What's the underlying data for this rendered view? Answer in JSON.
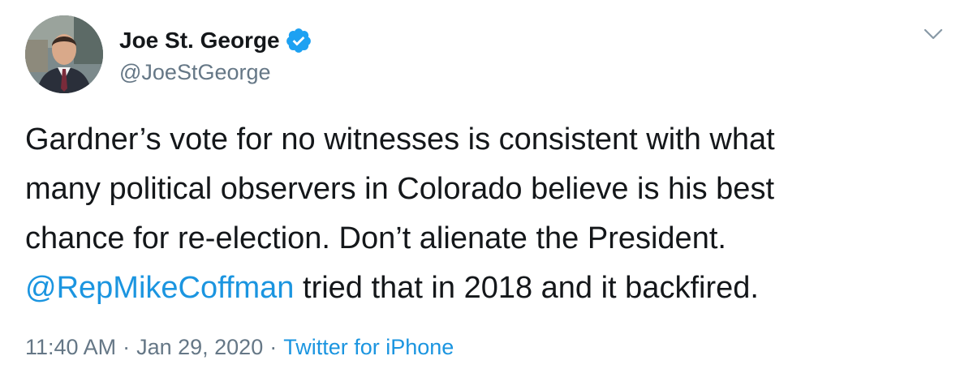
{
  "author": {
    "display_name": "Joe St. George",
    "handle": "@JoeStGeorge",
    "verified": true,
    "avatar_icon": "profile-photo"
  },
  "tweet": {
    "lines": [
      {
        "text": "Gardner’s vote for no witnesses is consistent with what"
      },
      {
        "text": "many political observers in Colorado believe is his best"
      },
      {
        "text": "chance for re-election. Don’t alienate the President."
      }
    ],
    "last_line": {
      "mention": "@RepMikeCoffman",
      "rest": " tried that in 2018 and it backfired."
    }
  },
  "meta": {
    "time": "11:40 AM",
    "separator": "·",
    "date": "Jan 29, 2020",
    "source": "Twitter for iPhone"
  },
  "icons": {
    "verified": "verified-badge-icon",
    "menu": "chevron-down-icon"
  },
  "colors": {
    "link": "#1b95e0",
    "text": "#14171a",
    "secondary": "#657786",
    "verified": "#1da1f2"
  }
}
